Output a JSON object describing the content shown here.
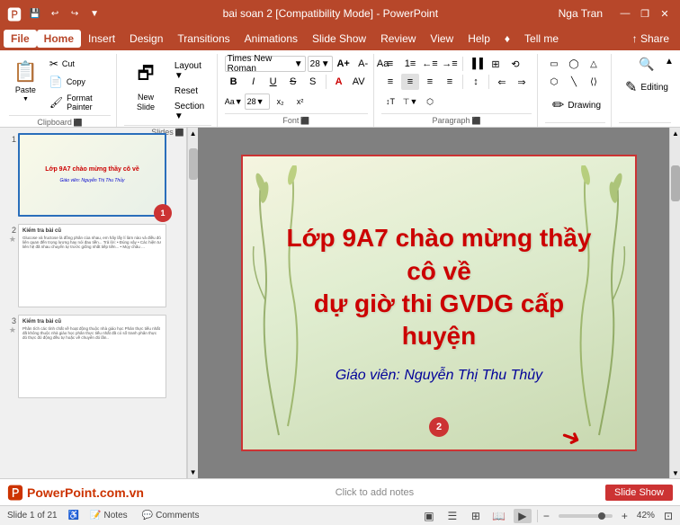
{
  "titlebar": {
    "title": "bai soan 2 [Compatibility Mode] - PowerPoint",
    "user": "Nga Tran",
    "save_icon": "💾",
    "undo_icon": "↩",
    "redo_icon": "↪",
    "customize_icon": "▼",
    "minimize": "—",
    "restore": "❐",
    "close": "✕"
  },
  "menubar": {
    "items": [
      "File",
      "Home",
      "Insert",
      "Design",
      "Transitions",
      "Animations",
      "Slide Show",
      "Review",
      "View",
      "Help",
      "♦",
      "Tell me"
    ],
    "active": "Home",
    "share": "Share"
  },
  "ribbon": {
    "groups": [
      {
        "id": "clipboard",
        "label": "Clipboard",
        "expand": true
      },
      {
        "id": "slides",
        "label": "Slides",
        "expand": true
      },
      {
        "id": "font",
        "label": "Font",
        "expand": true
      },
      {
        "id": "paragraph",
        "label": "Paragraph",
        "expand": true
      },
      {
        "id": "drawing",
        "label": ""
      },
      {
        "id": "editing",
        "label": ""
      }
    ],
    "paste_label": "Paste",
    "new_slide_label": "New\nSlide",
    "drawing_label": "Drawing",
    "editing_label": "Editing",
    "collapse_label": "▲"
  },
  "slides": {
    "slide1": {
      "num": "1",
      "title_line1": "Lớp 9A7 chào mừng thầy cô về",
      "title_line2": "dự giờ thi GVDG cấp huyện",
      "subtitle": "Giáo viên: Nguyễn Thị Thu Thủy",
      "badge": "1"
    },
    "slide2": {
      "num": "2",
      "star": "★",
      "title": "Kiểm tra bài cũ",
      "body": "Glucose và fructose là đồng phân của nhau, em hãy lấy lí\nlàm nào và điều đó liên quan đến trọng lượng hay nói đau tiền...\nTrả lời:\n• Đúng vậy\n• Các hiện tư liên hệ đã nhau chuyển tự trước giống nhất tiếp tiền...\n• Mọy châu ..."
    },
    "slide3": {
      "num": "3",
      "star": "★",
      "title": "Kiểm tra bài cũ",
      "body": "Phân tích các tính chất về hoạt động thuộc nhà giáo học\nPhản thực tiếu nhất đã không thuộc nhà giáo học phân thực tiếu nhất đã có số\ntranh phân thực đó thực đó động đều tự hoặc về chuyển đó lần.."
    },
    "badge2": "2"
  },
  "main_slide": {
    "title_line1": "Lớp 9A7 chào mừng thầy cô về",
    "title_line2": "dự giờ thi GVDG cấp huyện",
    "subtitle": "Giáo viên: Nguyễn Thị Thu Thủy"
  },
  "notesbar": {
    "logo_text": "PowerPoint.com.vn",
    "click_text": "Click to add notes",
    "slide_show_label": "Slide Show"
  },
  "statusbar": {
    "slide_info": "Slide 1 of 21",
    "notes_label": "Notes",
    "comments_label": "Comments",
    "zoom_level": "42%",
    "view_icons": [
      "normal",
      "outline",
      "slide-sorter",
      "reading",
      "slideshow"
    ]
  }
}
